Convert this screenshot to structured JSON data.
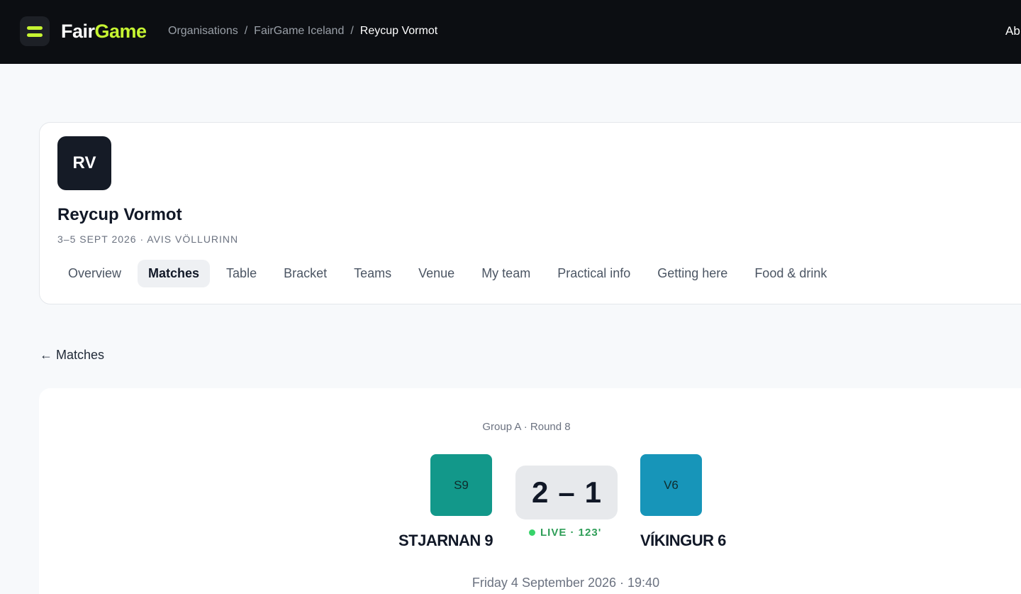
{
  "brand": {
    "part1": "Fair",
    "part2": "Game"
  },
  "breadcrumb": {
    "items": [
      "Organisations",
      "FairGame Iceland",
      "Reycup Vormot"
    ],
    "separator": "/"
  },
  "topbar": {
    "right_text": "Ab"
  },
  "event": {
    "initials": "RV",
    "title": "Reycup Vormot",
    "meta": "3–5 SEPT 2026 · AVIS VÖLLURINN"
  },
  "tabs": [
    {
      "label": "Overview",
      "active": false
    },
    {
      "label": "Matches",
      "active": true
    },
    {
      "label": "Table",
      "active": false
    },
    {
      "label": "Bracket",
      "active": false
    },
    {
      "label": "Teams",
      "active": false
    },
    {
      "label": "Venue",
      "active": false
    },
    {
      "label": "My team",
      "active": false
    },
    {
      "label": "Practical info",
      "active": false
    },
    {
      "label": "Getting here",
      "active": false
    },
    {
      "label": "Food & drink",
      "active": false
    }
  ],
  "back_link": "← Matches",
  "match": {
    "round": "Group A · Round 8",
    "home": {
      "short": "S9",
      "name": "STJARNAN 9",
      "color": "#12988a"
    },
    "away": {
      "short": "V6",
      "name": "VÍKINGUR 6",
      "color": "#1795b9"
    },
    "score_home": "2",
    "score_sep": "–",
    "score_away": "1",
    "status": "LIVE · 123'",
    "kickoff": "Friday 4 September 2026 · 19:40"
  },
  "colors": {
    "topbar_bg": "#0c0e12",
    "accent": "#c6f432",
    "live_green": "#2f9e58"
  }
}
